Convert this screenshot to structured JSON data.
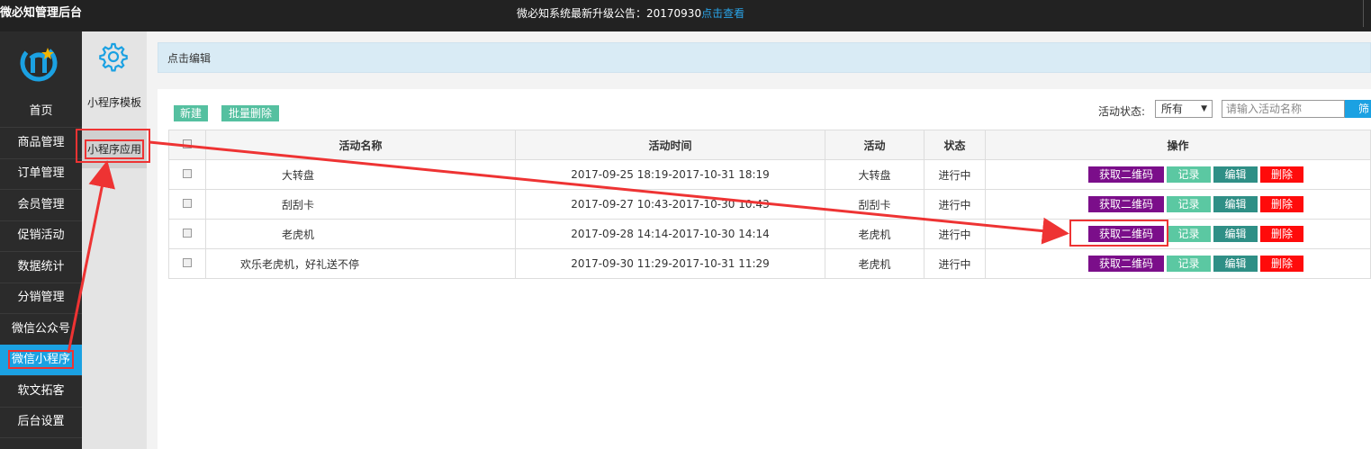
{
  "topbar": {
    "brand": "微必知管理后台",
    "notice_text": "微必知系统最新升级公告：20170930",
    "notice_link": "点击查看"
  },
  "sidebar": {
    "items": [
      {
        "label": "首页"
      },
      {
        "label": "商品管理"
      },
      {
        "label": "订单管理"
      },
      {
        "label": "会员管理"
      },
      {
        "label": "促销活动"
      },
      {
        "label": "数据统计"
      },
      {
        "label": "分销管理"
      },
      {
        "label": "微信公众号"
      },
      {
        "label": "微信小程序",
        "active": true
      },
      {
        "label": "软文拓客"
      },
      {
        "label": "后台设置"
      }
    ]
  },
  "subnav": {
    "items": [
      {
        "label": "小程序模板"
      },
      {
        "label": "小程序应用",
        "active": true
      }
    ]
  },
  "breadcrumb": "点击编辑",
  "toolbar": {
    "new_label": "新建",
    "batch_delete_label": "批量删除",
    "status_label": "活动状态:",
    "status_value": "所有",
    "search_placeholder": "请输入活动名称",
    "search_button": "筛"
  },
  "table": {
    "headers": [
      "活动名称",
      "活动时间",
      "活动",
      "状态",
      "操作"
    ],
    "rows": [
      {
        "name": "大转盘",
        "time": "2017-09-25 18:19-2017-10-31 18:19",
        "type": "大转盘",
        "status": "进行中"
      },
      {
        "name": "刮刮卡",
        "time": "2017-09-27 10:43-2017-10-30 10:43",
        "type": "刮刮卡",
        "status": "进行中"
      },
      {
        "name": "老虎机",
        "time": "2017-09-28 14:14-2017-10-30 14:14",
        "type": "老虎机",
        "status": "进行中"
      },
      {
        "name": "欢乐老虎机，好礼送不停",
        "time": "2017-09-30 11:29-2017-10-31 11:29",
        "type": "老虎机",
        "status": "进行中"
      }
    ],
    "actions": {
      "qrcode": "获取二维码",
      "log": "记录",
      "edit": "编辑",
      "delete": "删除"
    }
  },
  "colors": {
    "accent": "#1ba1e2",
    "qrcode_button": "#7b0e8a",
    "log_button": "#5bc8a2",
    "edit_button": "#2f8f86",
    "delete_button": "#ff0b0b",
    "annotation": "#ee3333"
  }
}
